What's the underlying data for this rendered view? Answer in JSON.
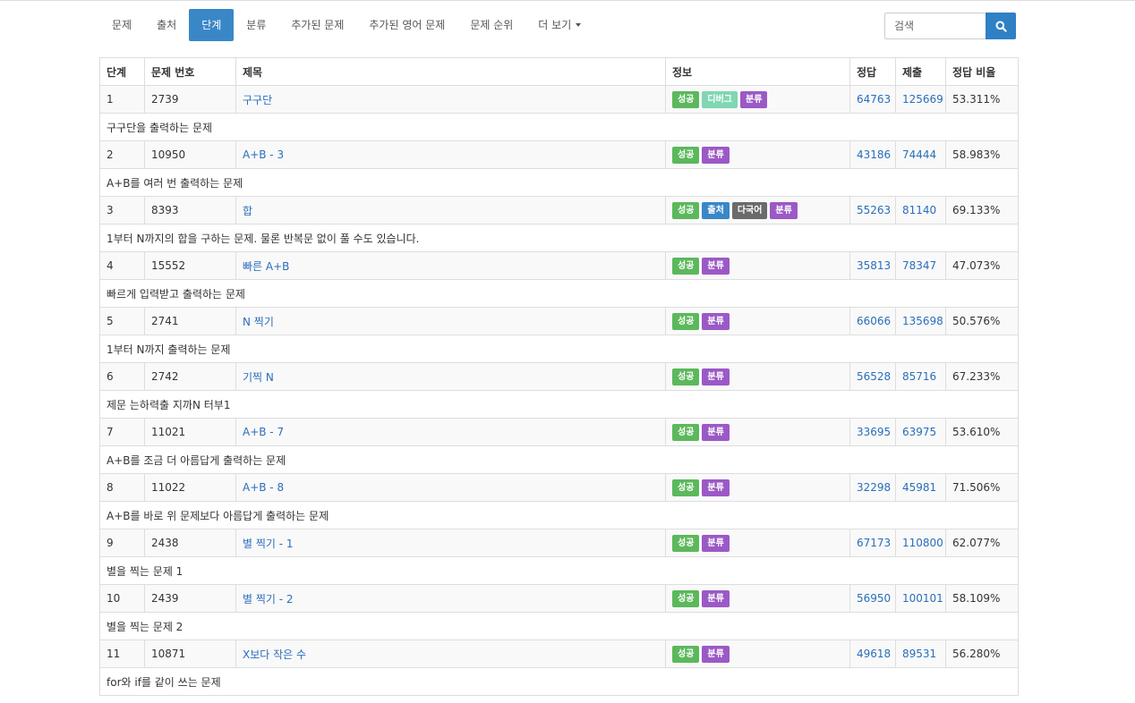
{
  "nav": {
    "tabs": [
      {
        "label": "문제",
        "name": "tab-problems",
        "active": false
      },
      {
        "label": "출처",
        "name": "tab-source",
        "active": false
      },
      {
        "label": "단계",
        "name": "tab-steps",
        "active": true
      },
      {
        "label": "분류",
        "name": "tab-category",
        "active": false
      },
      {
        "label": "추가된 문제",
        "name": "tab-added-problems",
        "active": false
      },
      {
        "label": "추가된 영어 문제",
        "name": "tab-added-english-problems",
        "active": false
      },
      {
        "label": "문제 순위",
        "name": "tab-problem-ranking",
        "active": false
      },
      {
        "label": "더 보기",
        "name": "tab-more",
        "active": false,
        "dropdown": true
      }
    ]
  },
  "search": {
    "placeholder": "검색",
    "icon": "search-icon"
  },
  "table": {
    "headers": [
      "단계",
      "문제 번호",
      "제목",
      "정보",
      "정답",
      "제출",
      "정답 비율"
    ],
    "label_colors": {
      "성공": "#5cb85c",
      "디버그": "#7fd7b3",
      "분류": "#9b59c6",
      "출처": "#3a87c8",
      "다국어": "#6b6b6b"
    },
    "rows": [
      {
        "step": "1",
        "id": "2739",
        "title": "구구단",
        "labels": [
          "성공",
          "디버그",
          "분류"
        ],
        "correct": "64763",
        "submissions": "125669",
        "ratio": "53.311%",
        "description": "구구단을 출력하는 문제"
      },
      {
        "step": "2",
        "id": "10950",
        "title": "A+B - 3",
        "labels": [
          "성공",
          "분류"
        ],
        "correct": "43186",
        "submissions": "74444",
        "ratio": "58.983%",
        "description": "A+B를 여러 번 출력하는 문제"
      },
      {
        "step": "3",
        "id": "8393",
        "title": "합",
        "labels": [
          "성공",
          "출처",
          "다국어",
          "분류"
        ],
        "correct": "55263",
        "submissions": "81140",
        "ratio": "69.133%",
        "description": "1부터 N까지의 합을 구하는 문제. 물론 반복문 없이 풀 수도 있습니다."
      },
      {
        "step": "4",
        "id": "15552",
        "title": "빠른 A+B",
        "labels": [
          "성공",
          "분류"
        ],
        "correct": "35813",
        "submissions": "78347",
        "ratio": "47.073%",
        "description": "빠르게 입력받고 출력하는 문제"
      },
      {
        "step": "5",
        "id": "2741",
        "title": "N 찍기",
        "labels": [
          "성공",
          "분류"
        ],
        "correct": "66066",
        "submissions": "135698",
        "ratio": "50.576%",
        "description": "1부터 N까지 출력하는 문제"
      },
      {
        "step": "6",
        "id": "2742",
        "title": "기찍 N",
        "labels": [
          "성공",
          "분류"
        ],
        "correct": "56528",
        "submissions": "85716",
        "ratio": "67.233%",
        "description": "제문 는하력출 지까N 터부1"
      },
      {
        "step": "7",
        "id": "11021",
        "title": "A+B - 7",
        "labels": [
          "성공",
          "분류"
        ],
        "correct": "33695",
        "submissions": "63975",
        "ratio": "53.610%",
        "description": "A+B를 조금 더 아름답게 출력하는 문제"
      },
      {
        "step": "8",
        "id": "11022",
        "title": "A+B - 8",
        "labels": [
          "성공",
          "분류"
        ],
        "correct": "32298",
        "submissions": "45981",
        "ratio": "71.506%",
        "description": "A+B를 바로 위 문제보다 아름답게 출력하는 문제"
      },
      {
        "step": "9",
        "id": "2438",
        "title": "별 찍기 - 1",
        "labels": [
          "성공",
          "분류"
        ],
        "correct": "67173",
        "submissions": "110800",
        "ratio": "62.077%",
        "description": "별을 찍는 문제 1"
      },
      {
        "step": "10",
        "id": "2439",
        "title": "별 찍기 - 2",
        "labels": [
          "성공",
          "분류"
        ],
        "correct": "56950",
        "submissions": "100101",
        "ratio": "58.109%",
        "description": "별을 찍는 문제 2"
      },
      {
        "step": "11",
        "id": "10871",
        "title": "X보다 작은 수",
        "labels": [
          "성공",
          "분류"
        ],
        "correct": "49618",
        "submissions": "89531",
        "ratio": "56.280%",
        "description": "for와 if를 같이 쓰는 문제"
      }
    ]
  }
}
